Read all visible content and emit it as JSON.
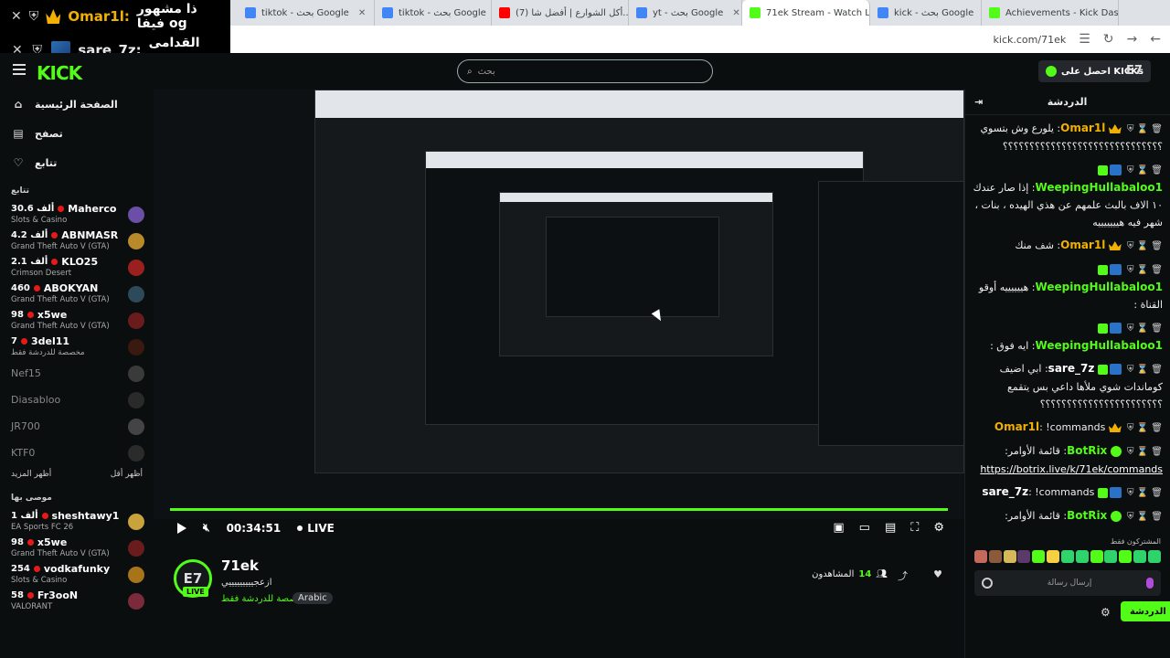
{
  "overlay": {
    "rows": [
      {
        "name": "Omar1l:",
        "message": "ذا مشهور فيفا og",
        "color": "#f2b100"
      },
      {
        "name": "sare_7z:",
        "message": "القدامى go",
        "color": "#ffffff"
      }
    ]
  },
  "browser": {
    "tabs": [
      {
        "label": "tiktok - بحث Google",
        "favicon_color": "#4285f4"
      },
      {
        "label": "tiktok - بحث Google",
        "favicon_color": "#4285f4"
      },
      {
        "label": "(7) أكل الشوارع | أفضل شا...",
        "favicon_color": "#ff0000"
      },
      {
        "label": "yt - بحث Google",
        "favicon_color": "#4285f4"
      },
      {
        "label": "71ek Stream - Watch Live",
        "favicon_color": "#53fc18"
      },
      {
        "label": "kick - بحث Google",
        "favicon_color": "#4285f4"
      },
      {
        "label": "Achievements - Kick Das...",
        "favicon_color": "#53fc18"
      }
    ],
    "url": "kick.com/71ek"
  },
  "header": {
    "logo": "KICK",
    "search_placeholder": "بحث",
    "get_kicks": "احصل على KICKs",
    "user_initial": "E7"
  },
  "sidebar": {
    "nav": [
      {
        "label": "الصفحة الرئيسية",
        "icon": "home-icon",
        "glyph": "⌂"
      },
      {
        "label": "تصفح",
        "icon": "browse-icon",
        "glyph": "▤"
      },
      {
        "label": "تتابع",
        "icon": "heart-icon",
        "glyph": "♡"
      }
    ],
    "following_title": "تتابع",
    "following": [
      {
        "name": "Maherco",
        "count": "30.6 ألف",
        "category": "Slots & Casino",
        "avatar": "#6b4fa6"
      },
      {
        "name": "ABNMASR",
        "count": "4.2 ألف",
        "category": "Grand Theft Auto V (GTA)",
        "avatar": "#b88a2a"
      },
      {
        "name": "KLO25",
        "count": "2.1 ألف",
        "category": "Crimson Desert",
        "avatar": "#9a1f1f"
      },
      {
        "name": "ABOKYAN",
        "count": "460",
        "category": "Grand Theft Auto V (GTA)",
        "avatar": "#2d4a5a"
      },
      {
        "name": "x5we",
        "count": "98",
        "category": "Grand Theft Auto V (GTA)",
        "avatar": "#6a1c1c"
      },
      {
        "name": "3del11",
        "count": "7",
        "category": "مخصصة للدردشة فقط",
        "avatar": "#3a1a10"
      }
    ],
    "offline": [
      {
        "name": "Nef15",
        "avatar": "#3a3a3a"
      },
      {
        "name": "Diasabloo",
        "avatar": "#2a2a2a"
      },
      {
        "name": "JR700",
        "avatar": "#444444"
      },
      {
        "name": "KTF0",
        "avatar": "#2b2b2b"
      }
    ],
    "show_more": "أظهر المزيد",
    "show_less": "أظهر أقل",
    "recommended_title": "موصى بها",
    "recommended": [
      {
        "name": "sheshtawy1",
        "count": "1 ألف",
        "category": "EA Sports FC 26",
        "avatar": "#c8a23a"
      },
      {
        "name": "x5we",
        "count": "98",
        "category": "Grand Theft Auto V (GTA)",
        "avatar": "#6a1c1c"
      },
      {
        "name": "vodkafunky",
        "count": "254",
        "category": "Slots & Casino",
        "avatar": "#a8741a"
      },
      {
        "name": "Fr3ooN",
        "count": "58",
        "category": "VALORANT",
        "avatar": "#7a2a3a"
      }
    ]
  },
  "player": {
    "time": "00:34:51",
    "live_label": "LIVE"
  },
  "stream": {
    "streamer": "71ek",
    "avatar_text": "E7",
    "live_tag": "LIVE",
    "title": "ازعجيييييييييي",
    "category": "مخصصة للدردشة فقط",
    "tag": "Arabic",
    "viewers_label": "المشاهدون",
    "viewers": "14"
  },
  "chat": {
    "title": "الدردشة",
    "messages": [
      {
        "user": "Omar1l",
        "color": "#f2b100",
        "badge": "crown",
        "text": "يلورع وش بتسوي ؟؟؟؟؟؟؟؟؟؟؟؟؟؟؟؟؟؟؟؟؟؟؟؟؟؟؟؟؟؟"
      },
      {
        "user": "WeepingHullabaloo1",
        "color": "#53fc18",
        "badge": "sub",
        "text": "إذا صار عندك ١٠ الاف بالبث علمهم عن هذي الهيده ، بنات ، شهر فيه هيييييييه"
      },
      {
        "user": "Omar1l",
        "color": "#f2b100",
        "badge": "crown",
        "text": "شف منك"
      },
      {
        "user": "WeepingHullabaloo1",
        "color": "#53fc18",
        "badge": "sub",
        "text": "هييييييه أوقو القناة :"
      },
      {
        "user": "WeepingHullabaloo1",
        "color": "#53fc18",
        "badge": "sub",
        "text": "ايه فوق :"
      },
      {
        "user": "sare_7z",
        "color": "#ffffff",
        "badge": "sub",
        "text": "ابي اضيف كوماندات شوي ملأها داعي بس يتقمع ؟؟؟؟؟؟؟؟؟؟؟؟؟؟؟؟؟؟؟؟؟؟؟"
      },
      {
        "user": "Omar1l",
        "color": "#f2b100",
        "badge": "crown",
        "text": "!commands"
      },
      {
        "user": "BotRix",
        "color": "#53fc18",
        "badge": "bot",
        "text": "قائمة الأوامر:",
        "link": "https://botrix.live/k/71ek/commands"
      },
      {
        "user": "sare_7z",
        "color": "#ffffff",
        "badge": "sub",
        "text": "!commands"
      },
      {
        "user": "BotRix",
        "color": "#53fc18",
        "badge": "bot",
        "text": "قائمة الأوامر:",
        "link": "https://botrix.live/k/71ek/commands"
      }
    ],
    "subs_label": "المشتركون فقط",
    "input_placeholder": "إرسال رسالة",
    "send_label": "الدردشة",
    "emote_colors": [
      "#c46a5a",
      "#8a5a3a",
      "#d4b85a",
      "#5a3a6a",
      "#53fc18",
      "#f5d040",
      "#2ed36b",
      "#2ed36b",
      "#53fc18",
      "#2ed36b",
      "#53fc18",
      "#2ed36b",
      "#2ed36b"
    ]
  }
}
